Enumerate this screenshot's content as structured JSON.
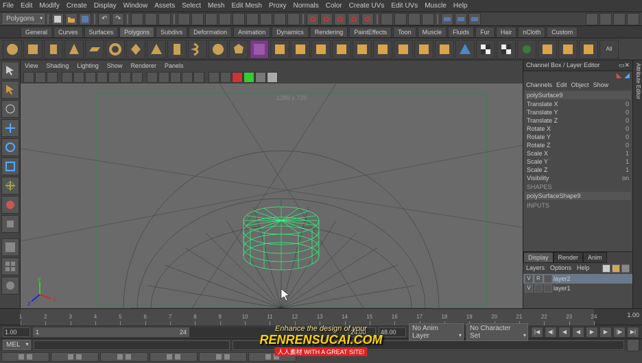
{
  "menubar": [
    "File",
    "Edit",
    "Modify",
    "Create",
    "Display",
    "Window",
    "Assets",
    "Select",
    "Mesh",
    "Edit Mesh",
    "Proxy",
    "Normals",
    "Color",
    "Create UVs",
    "Edit UVs",
    "Muscle",
    "Help"
  ],
  "moduleDropdown": "Polygons",
  "shelfTabs": [
    "General",
    "Curves",
    "Surfaces",
    "Polygons",
    "Subdivs",
    "Deformation",
    "Animation",
    "Dynamics",
    "Rendering",
    "PaintEffects",
    "Toon",
    "Muscle",
    "Fluids",
    "Fur",
    "Hair",
    "nCloth",
    "Custom"
  ],
  "activeShelfTab": "Polygons",
  "viewportMenu": [
    "View",
    "Shading",
    "Lighting",
    "Show",
    "Renderer",
    "Panels"
  ],
  "resolutionGate": "1280 x 720",
  "channelBox": {
    "title": "Channel Box / Layer Editor",
    "menus": [
      "Channels",
      "Edit",
      "Object",
      "Show"
    ],
    "objectName": "polySurface9",
    "attrs": [
      {
        "label": "Translate X",
        "value": "0"
      },
      {
        "label": "Translate Y",
        "value": "0"
      },
      {
        "label": "Translate Z",
        "value": "0"
      },
      {
        "label": "Rotate X",
        "value": "0"
      },
      {
        "label": "Rotate Y",
        "value": "0"
      },
      {
        "label": "Rotate Z",
        "value": "0"
      },
      {
        "label": "Scale X",
        "value": "1"
      },
      {
        "label": "Scale Y",
        "value": "1"
      },
      {
        "label": "Scale Z",
        "value": "1"
      },
      {
        "label": "Visibility",
        "value": "on"
      }
    ],
    "shapesLabel": "SHAPES",
    "shapeName": "polySurfaceShape9",
    "inputsLabel": "INPUTS"
  },
  "layerPanel": {
    "tabs": [
      "Display",
      "Render",
      "Anim"
    ],
    "activeTab": "Display",
    "menus": [
      "Layers",
      "Options",
      "Help"
    ],
    "layers": [
      {
        "name": "layer2",
        "vis": "V",
        "type": "R",
        "selected": true
      },
      {
        "name": "layer1",
        "vis": "V",
        "type": "",
        "selected": false
      }
    ]
  },
  "sideTab": "Attribute Editor",
  "timeline": {
    "ticks": [
      1,
      2,
      3,
      4,
      5,
      6,
      7,
      8,
      9,
      10,
      11,
      12,
      13,
      14,
      15,
      16,
      17,
      18,
      19,
      20,
      21,
      22,
      23,
      24
    ],
    "current": "1.00",
    "playbackEnd": "1.00"
  },
  "rangeSlider": {
    "startOuter": "1.00",
    "startInner": "1",
    "endInner": "24",
    "endOuter": "24.00",
    "rangeEnd": "48.00",
    "animLayer": "No Anim Layer",
    "charSet": "No Character Set"
  },
  "commandLine": {
    "label": "MEL"
  },
  "watermark": {
    "line1": "Enhance the design of your",
    "line2": "RENRENSUCAI.COM",
    "line3": "人人素材 WITH A GREAT SITE!"
  }
}
